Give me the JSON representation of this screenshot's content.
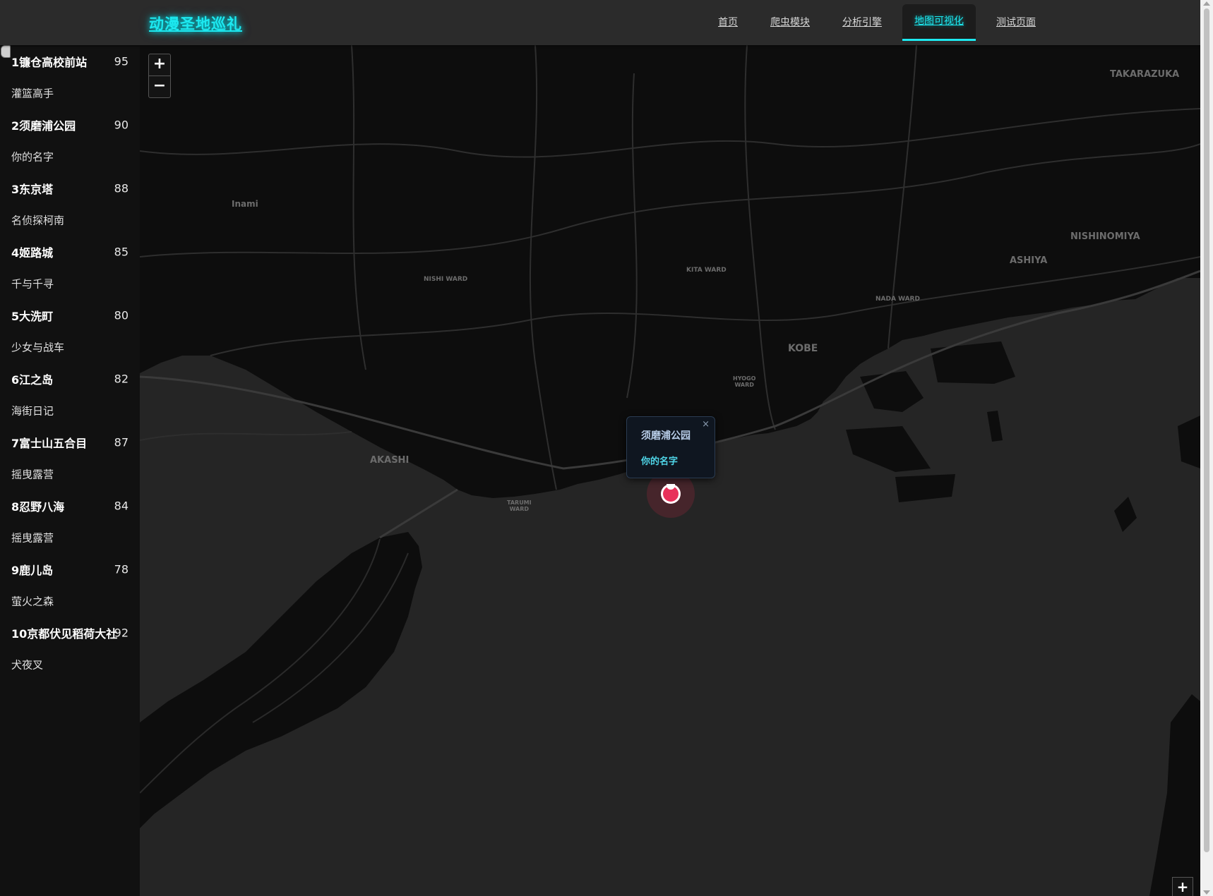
{
  "header": {
    "brand": "动漫圣地巡礼",
    "nav": [
      {
        "label": "首页",
        "active": false
      },
      {
        "label": "爬虫模块",
        "active": false
      },
      {
        "label": "分析引擎",
        "active": false
      },
      {
        "label": "地图可视化",
        "active": true
      },
      {
        "label": "测试页面",
        "active": false
      }
    ]
  },
  "sidebar": {
    "spots": [
      {
        "name": "1镰仓高校前站",
        "score": "95",
        "anime": "灌篮高手"
      },
      {
        "name": "2须磨浦公园",
        "score": "90",
        "anime": "你的名字"
      },
      {
        "name": "3东京塔",
        "score": "88",
        "anime": "名侦探柯南"
      },
      {
        "name": "4姬路城",
        "score": "85",
        "anime": "千与千寻"
      },
      {
        "name": "5大洗町",
        "score": "80",
        "anime": "少女与战车"
      },
      {
        "name": "6江之岛",
        "score": "82",
        "anime": "海街日记"
      },
      {
        "name": "7富士山五合目",
        "score": "87",
        "anime": "摇曳露营"
      },
      {
        "name": "8忍野八海",
        "score": "84",
        "anime": "摇曳露营"
      },
      {
        "name": "9鹿儿岛",
        "score": "78",
        "anime": "萤火之森"
      },
      {
        "name": "10京都伏见稻荷大社",
        "score": "92",
        "anime": "犬夜叉"
      }
    ]
  },
  "map": {
    "zoom_in": "+",
    "zoom_out": "−",
    "corner_zoom": "+",
    "labels": {
      "takarazuka": "TAKARAZUKA",
      "nishinomiya": "NISHINOMIYA",
      "ashiya": "ASHIYA",
      "kobe": "KOBE",
      "akashi": "AKASHI",
      "inami": "Inami",
      "nishi_ward": "NISHI WARD",
      "kita_ward": "KITA WARD",
      "nada_ward": "NADA WARD",
      "hyogo_ward": "HYOGO\nWARD",
      "tarumi_ward": "TARUMI\nWARD"
    },
    "popup": {
      "title": "须磨浦公园",
      "subtitle": "你的名字",
      "close": "×"
    },
    "colors": {
      "land": "#0d0d0d",
      "water": "#252525",
      "road": "#2e2e2e",
      "marker": "#e8315a",
      "accent": "#1de9f0"
    }
  }
}
